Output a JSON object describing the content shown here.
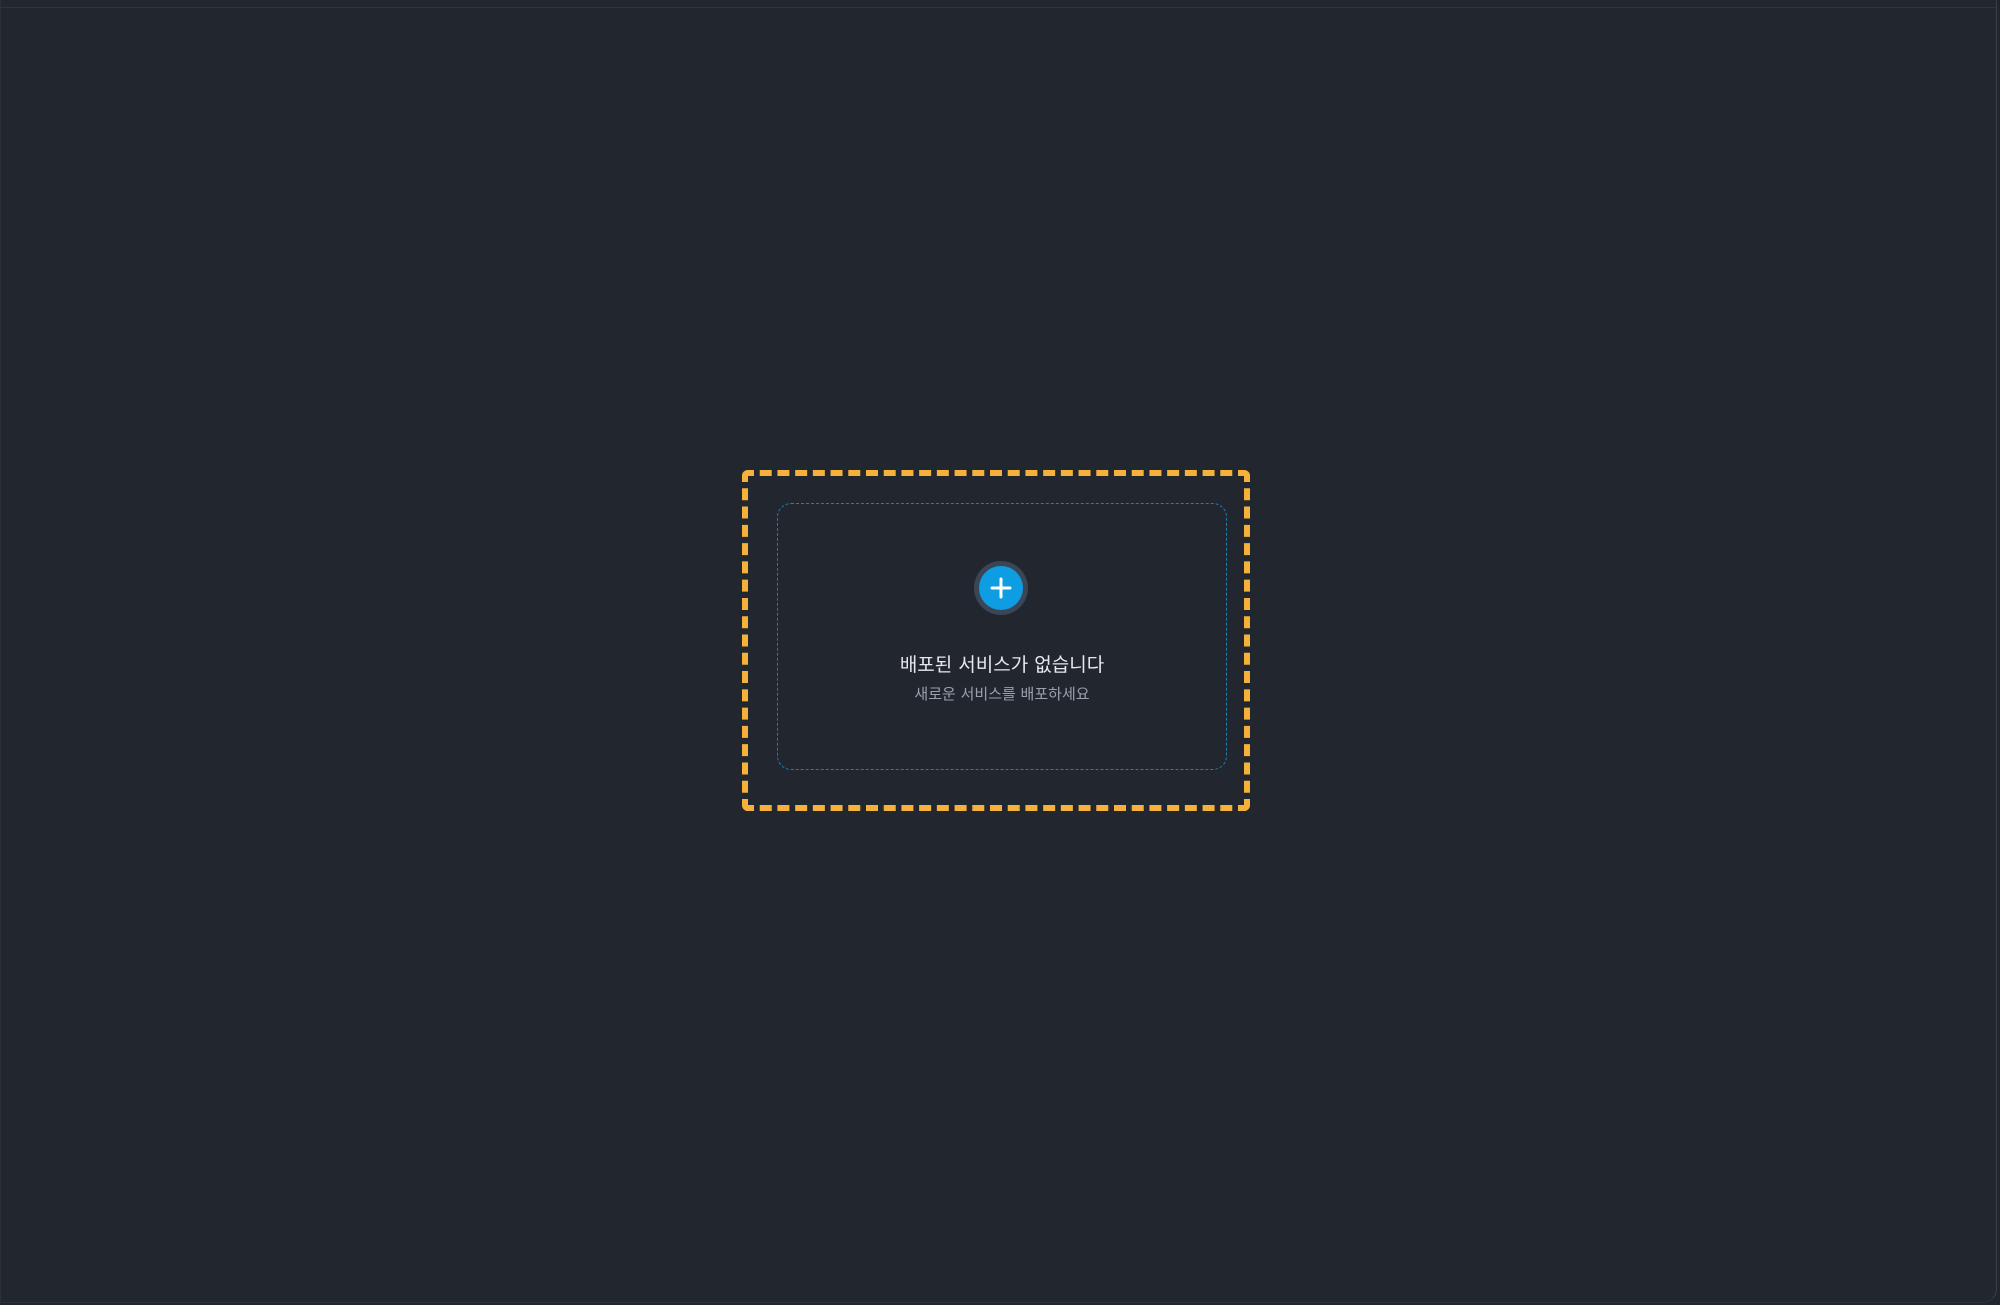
{
  "empty_state": {
    "title": "배포된 서비스가 없습니다",
    "subtitle": "새로운 서비스를 배포하세요",
    "icon": "plus-icon"
  },
  "colors": {
    "background": "#22262e",
    "highlight_border": "#f5b13a",
    "card_border": "#1f7fb0",
    "accent": "#0e9de3",
    "title_text": "#e6e8ec",
    "subtitle_text": "#9aa1ab"
  }
}
